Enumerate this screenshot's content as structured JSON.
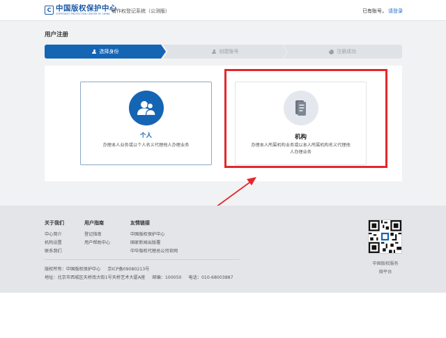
{
  "header": {
    "logo_mark": "C",
    "logo_main": "中国版权保护中心",
    "logo_sub": "COPYRIGHT PROTECTION CENTER OF CHINA",
    "system_title": "著作权登记系统（公测版）",
    "account_prompt": "已有账号，",
    "login_link": "请登录"
  },
  "page": {
    "title": "用户注册"
  },
  "steps": [
    {
      "label": "选择身份",
      "icon": "person-icon",
      "state": "active"
    },
    {
      "label": "创建账号",
      "icon": "person-icon",
      "state": "inactive"
    },
    {
      "label": "注册成功",
      "icon": "check-circle-icon",
      "state": "inactive"
    }
  ],
  "cards": {
    "personal": {
      "title": "个人",
      "description": "办理本人业务或以个人名义代理他人办理业务",
      "icon": "users-icon"
    },
    "org": {
      "title": "机构",
      "description": "办理本人所属机构业务或以本人所属机构名义代理他人办理业务",
      "icon": "document-icon"
    }
  },
  "annotation": {
    "highlight_color": "#e5262a"
  },
  "footer": {
    "about": {
      "title": "关于我们",
      "links": [
        "中心简介",
        "机构设置",
        "联系我们"
      ]
    },
    "guide": {
      "title": "用户指南",
      "links": [
        "登记指南",
        "用户帮助中心"
      ]
    },
    "friends": {
      "title": "友情链接",
      "links": [
        "中国版权保护中心",
        "国家新闻出版署",
        "中华版权代理总公司官网"
      ]
    },
    "copyright_line1": [
      "版权所有：中国版权保护中心",
      "京ICP备09080213号"
    ],
    "copyright_line2": [
      "地址：北京市西城区天桥南大街1号天桥艺术大厦A座",
      "邮编：100050",
      "电话：010-68003887"
    ],
    "qr_caption_1": "中国版权服务",
    "qr_caption_2": "微平台"
  },
  "colors": {
    "primary": "#1565b5",
    "link": "#1f6fc5"
  }
}
